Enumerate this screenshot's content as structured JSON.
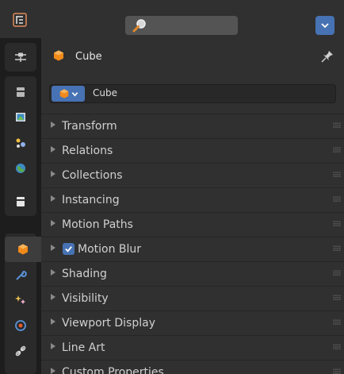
{
  "header": {
    "editor_type_icon": "properties-editor-icon",
    "search": {
      "icon": "search-icon",
      "placeholder": ""
    },
    "options_icon": "chevron-down-icon",
    "accent": "#4772b3"
  },
  "tabs": [
    {
      "name": "tab-tool",
      "icon": "tool-settings-icon"
    },
    {
      "name": "tab-render",
      "icon": "render-icon"
    },
    {
      "name": "tab-output",
      "icon": "output-icon"
    },
    {
      "name": "tab-view-layer",
      "icon": "view-layer-icon"
    },
    {
      "name": "tab-scene",
      "icon": "scene-icon"
    },
    {
      "name": "tab-world",
      "icon": "world-icon"
    },
    {
      "name": "tab-collection",
      "icon": "collection-icon"
    },
    {
      "name": "tab-object",
      "icon": "object-icon",
      "active": true
    },
    {
      "name": "tab-modifiers",
      "icon": "wrench-icon"
    },
    {
      "name": "tab-particles",
      "icon": "particles-icon"
    },
    {
      "name": "tab-physics",
      "icon": "physics-icon"
    },
    {
      "name": "tab-constraints",
      "icon": "constraints-icon"
    }
  ],
  "context": {
    "object_name": "Cube",
    "object_icon": "object-cube-icon",
    "pin_icon": "pin-icon"
  },
  "datablock": {
    "name": "Cube",
    "selector_icon": "object-cube-icon"
  },
  "sections": [
    {
      "label": "Transform"
    },
    {
      "label": "Relations"
    },
    {
      "label": "Collections"
    },
    {
      "label": "Instancing"
    },
    {
      "label": "Motion Paths"
    },
    {
      "label": "Motion Blur",
      "checkbox": true,
      "checked": true
    },
    {
      "label": "Shading"
    },
    {
      "label": "Visibility"
    },
    {
      "label": "Viewport Display"
    },
    {
      "label": "Line Art"
    },
    {
      "label": "Custom Properties"
    }
  ]
}
